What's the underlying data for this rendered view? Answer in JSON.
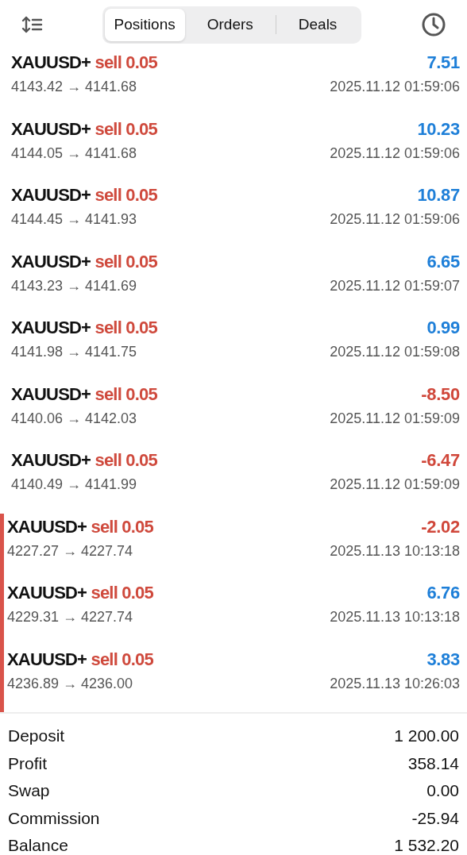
{
  "tabs": [
    {
      "label": "Positions",
      "selected": true
    },
    {
      "label": "Orders",
      "selected": false
    },
    {
      "label": "Deals",
      "selected": false
    }
  ],
  "deals": [
    {
      "symbol": "XAUUSD+",
      "side": "sell 0.05",
      "profit": "7.51",
      "color": "#1e7fd8",
      "prices": "4143.42 → 4141.68",
      "time": "2025.11.12 01:59:06",
      "marked": false
    },
    {
      "symbol": "XAUUSD+",
      "side": "sell 0.05",
      "profit": "10.23",
      "color": "#1e7fd8",
      "prices": "4144.05 → 4141.68",
      "time": "2025.11.12 01:59:06",
      "marked": false
    },
    {
      "symbol": "XAUUSD+",
      "side": "sell 0.05",
      "profit": "10.87",
      "color": "#1e7fd8",
      "prices": "4144.45 → 4141.93",
      "time": "2025.11.12 01:59:06",
      "marked": false
    },
    {
      "symbol": "XAUUSD+",
      "side": "sell 0.05",
      "profit": "6.65",
      "color": "#1e7fd8",
      "prices": "4143.23 → 4141.69",
      "time": "2025.11.12 01:59:07",
      "marked": false
    },
    {
      "symbol": "XAUUSD+",
      "side": "sell 0.05",
      "profit": "0.99",
      "color": "#1e7fd8",
      "prices": "4141.98 → 4141.75",
      "time": "2025.11.12 01:59:08",
      "marked": false
    },
    {
      "symbol": "XAUUSD+",
      "side": "sell 0.05",
      "profit": "-8.50",
      "color": "#d0473a",
      "prices": "4140.06 → 4142.03",
      "time": "2025.11.12 01:59:09",
      "marked": false
    },
    {
      "symbol": "XAUUSD+",
      "side": "sell 0.05",
      "profit": "-6.47",
      "color": "#d0473a",
      "prices": "4140.49 → 4141.99",
      "time": "2025.11.12 01:59:09",
      "marked": false
    },
    {
      "symbol": "XAUUSD+",
      "side": "sell 0.05",
      "profit": "-2.02",
      "color": "#d0473a",
      "prices": "4227.27 → 4227.74",
      "time": "2025.11.13 10:13:18",
      "marked": true
    },
    {
      "symbol": "XAUUSD+",
      "side": "sell 0.05",
      "profit": "6.76",
      "color": "#1e7fd8",
      "prices": "4229.31 → 4227.74",
      "time": "2025.11.13 10:13:18",
      "marked": true
    },
    {
      "symbol": "XAUUSD+",
      "side": "sell 0.05",
      "profit": "3.83",
      "color": "#1e7fd8",
      "prices": "4236.89 → 4236.00",
      "time": "2025.11.13 10:26:03",
      "marked": true
    }
  ],
  "summary": [
    {
      "label": "Deposit",
      "value": "1 200.00"
    },
    {
      "label": "Profit",
      "value": "358.14"
    },
    {
      "label": "Swap",
      "value": "0.00"
    },
    {
      "label": "Commission",
      "value": "-25.94"
    },
    {
      "label": "Balance",
      "value": "1 532.20"
    }
  ]
}
